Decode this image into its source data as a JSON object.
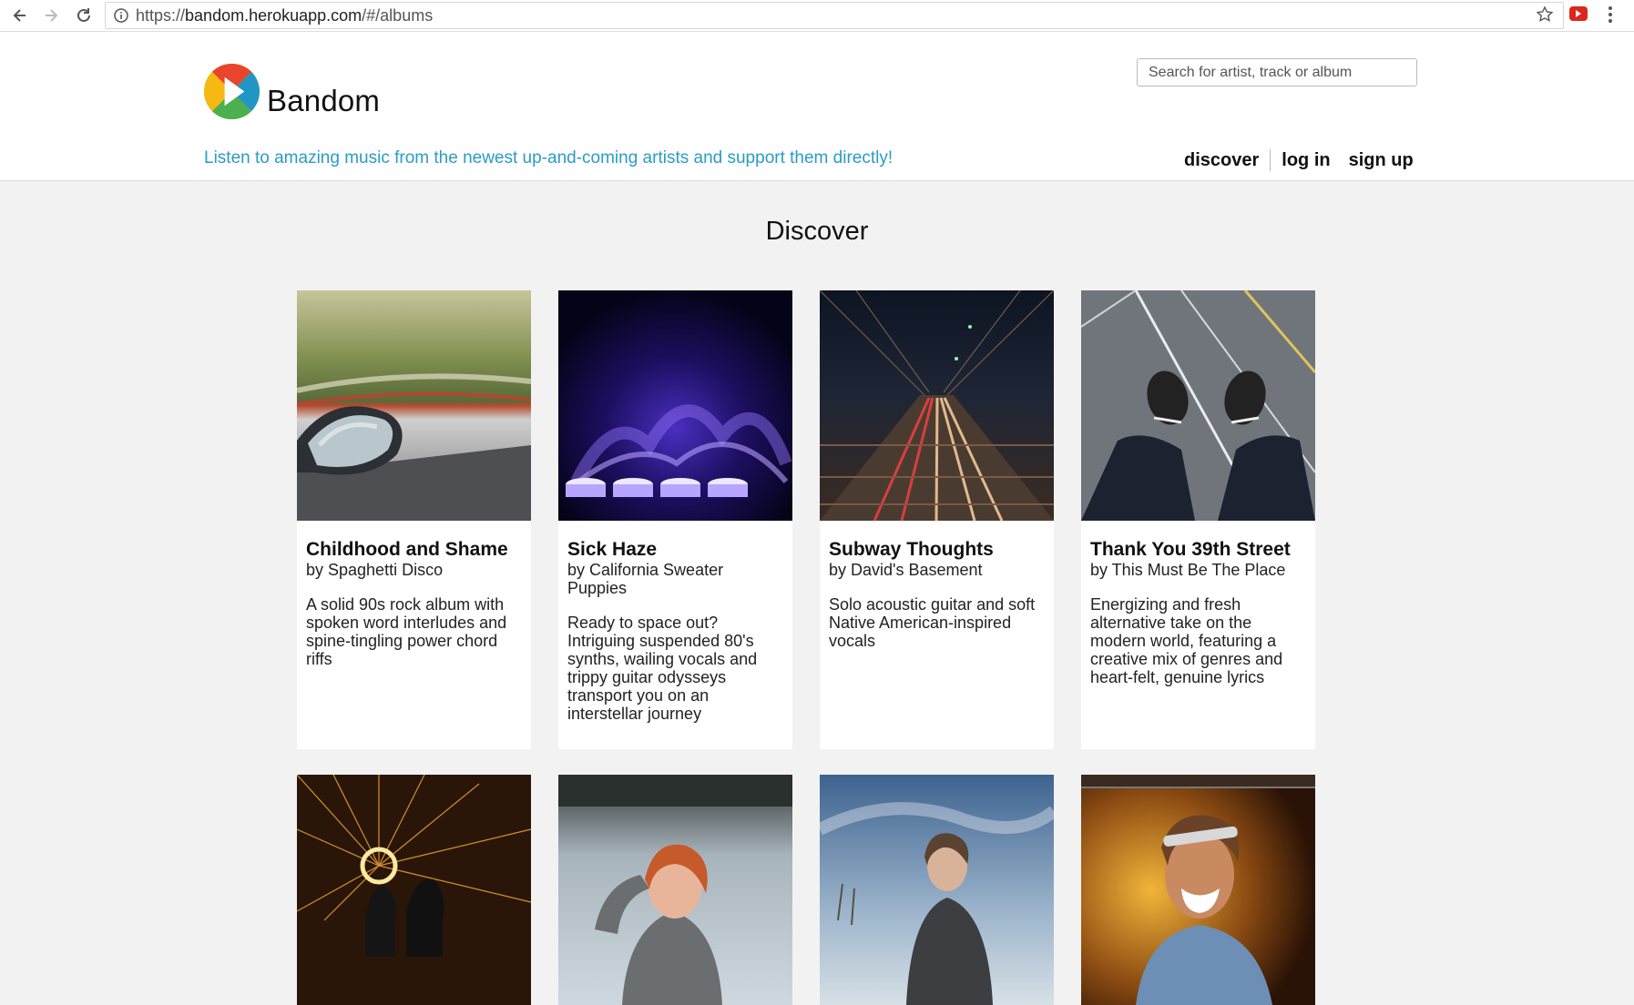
{
  "browser": {
    "url_prefix": "https://",
    "url_host": "bandom.herokuapp.com",
    "url_path": "/#/albums"
  },
  "site": {
    "brand": "Bandom",
    "tagline": "Listen to amazing music from the newest up-and-coming artists and support them directly!",
    "search_placeholder": "Search for artist, track or album",
    "nav": {
      "discover": "discover",
      "login": "log in",
      "signup": "sign up"
    },
    "logo_colors": [
      "#e8452c",
      "#f6b913",
      "#4caf50",
      "#2196c4"
    ]
  },
  "page": {
    "title": "Discover"
  },
  "albums": [
    {
      "title": "Childhood and Shame",
      "artist": "by Spaghetti Disco",
      "description": "A solid 90s rock album with spoken word interludes and spine-tingling power chord riffs"
    },
    {
      "title": "Sick Haze",
      "artist": "by California Sweater Puppies",
      "description": "Ready to space out? Intriguing suspended 80's synths, wailing vocals and trippy guitar odysseys transport you on an interstellar journey"
    },
    {
      "title": "Subway Thoughts",
      "artist": "by David's Basement",
      "description": "Solo acoustic guitar and soft Native American-inspired vocals"
    },
    {
      "title": "Thank You 39th Street",
      "artist": "by This Must Be The Place",
      "description": "Energizing and fresh alternative take on the modern world, featuring a creative mix of genres and heart-felt, genuine lyrics"
    }
  ]
}
